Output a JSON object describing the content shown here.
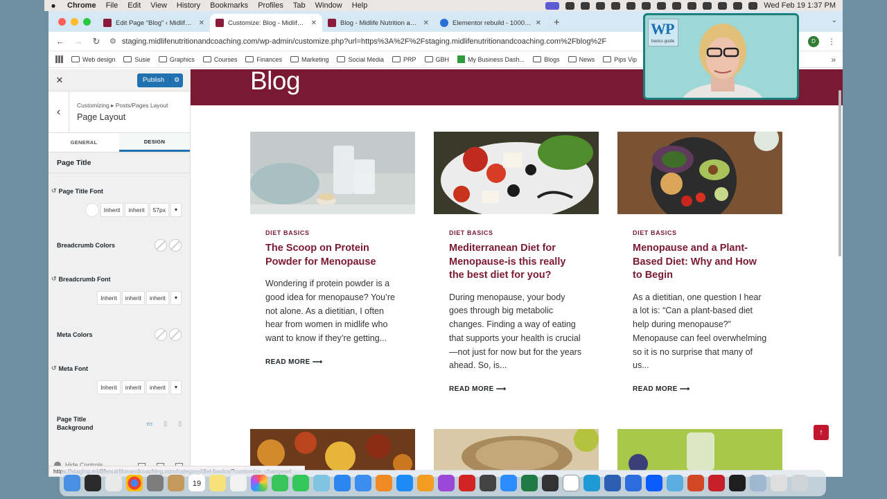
{
  "menubar": {
    "apple": "",
    "app": "Chrome",
    "items": [
      "File",
      "Edit",
      "View",
      "History",
      "Bookmarks",
      "Profiles",
      "Tab",
      "Window",
      "Help"
    ],
    "clock": "Wed Feb 19  1:37 PM"
  },
  "tabs": [
    {
      "label": "Edit Page “Blog” ‹ Midlife Nu",
      "active": false
    },
    {
      "label": "Customize: Blog - Midlife Nut",
      "active": true
    },
    {
      "label": "Blog - Midlife Nutrition and C",
      "active": false
    },
    {
      "label": "Elementor rebuild - 1000 × 3",
      "active": false
    }
  ],
  "toolbar": {
    "url": "staging.midlifenutritionandcoaching.com/wp-admin/customize.php?url=https%3A%2F%2Fstaging.midlifenutritionandcoaching.com%2Fblog%2F",
    "profile_initial": "D"
  },
  "bookmarks": [
    {
      "label": "Web design",
      "icon": "folder"
    },
    {
      "label": "Susie",
      "icon": "folder"
    },
    {
      "label": "Graphics",
      "icon": "folder"
    },
    {
      "label": "Courses",
      "icon": "folder"
    },
    {
      "label": "Finances",
      "icon": "folder"
    },
    {
      "label": "Marketing",
      "icon": "folder"
    },
    {
      "label": "Social Media",
      "icon": "folder"
    },
    {
      "label": "PRP",
      "icon": "folder"
    },
    {
      "label": "GBH",
      "icon": "folder"
    },
    {
      "label": "My Business Dash...",
      "icon": "green"
    },
    {
      "label": "Blogs",
      "icon": "folder"
    },
    {
      "label": "News",
      "icon": "folder"
    },
    {
      "label": "Pips Vip",
      "icon": "folder"
    }
  ],
  "customizer": {
    "close": "✕",
    "publish_label": "Publish",
    "breadcrumb": "Customizing ▸ Posts/Pages Layout",
    "title": "Page Layout",
    "tab_general": "GENERAL",
    "tab_design": "DESIGN",
    "section_title": "Page Title",
    "page_title_font": {
      "label": "Page Title Font",
      "family": "Inherit",
      "weight": "inherit",
      "size": "57px"
    },
    "breadcrumb_colors": {
      "label": "Breadcrumb Colors"
    },
    "breadcrumb_font": {
      "label": "Breadcrumb Font",
      "family": "Inherit",
      "weight": "inherit",
      "size": "inherit"
    },
    "meta_colors": {
      "label": "Meta Colors"
    },
    "meta_font": {
      "label": "Meta Font",
      "family": "Inherit",
      "weight": "inherit",
      "size": "inherit"
    },
    "page_title_background": {
      "label": "Page Title Background"
    },
    "hide_controls": "Hide Controls"
  },
  "preview": {
    "hero_title": "Blog",
    "posts": [
      {
        "category": "DIET BASICS",
        "title": "The Scoop on Protein Powder for Menopause",
        "excerpt": "Wondering if protein powder is a good idea for menopause? You’re not alone. As a dietitian, I often hear from women in midlife who want to know if they’re getting...",
        "read_more": "READ MORE ⟶"
      },
      {
        "category": "DIET BASICS",
        "title": "Mediterranean Diet for Menopause-is this really the best diet for you?",
        "excerpt": "During menopause, your body goes through big metabolic changes. Finding a way of eating that supports your health is crucial—not just for now but for the years ahead. So, is...",
        "read_more": "READ MORE ⟶"
      },
      {
        "category": "DIET BASICS",
        "title": "Menopause and a Plant-Based Diet: Why and How to Begin",
        "excerpt": "As a dietitian, one question I hear a lot is: “Can a plant-based diet help during menopause?” Menopause can feel overwhelming so it is no surprise that many of us...",
        "read_more": "READ MORE ⟶"
      }
    ],
    "back_to_top": "↑"
  },
  "status_url": "https://staging.midlifenutritionandcoaching.com/category/diet-basics/?customize_changeset_...",
  "webcam": {
    "logo_text": "WP",
    "logo_subtext": "basics guide"
  },
  "colors": {
    "brand": "#7a1a32",
    "accent": "#2271b1",
    "webcam_border": "#1d7f7c"
  },
  "dock": {
    "icons": [
      "finder-icon",
      "launchpad-icon",
      "apps-icon",
      "chrome-icon",
      "settings-icon",
      "finder-folder-icon",
      "calendar-icon",
      "notes-icon",
      "textedit-icon",
      "photos-icon",
      "facetime-icon",
      "messages-icon",
      "maps-icon",
      "files-icon",
      "mail-icon",
      "books-icon",
      "appstore-icon",
      "pages-icon",
      "podcasts-icon",
      "acrobat-icon",
      "sublime-icon",
      "safari-icon",
      "excel-icon",
      "quicktime-icon",
      "notion-icon",
      "edge-icon",
      "word-icon",
      "zoom-icon",
      "zoom-app-icon",
      "klack-icon",
      "powerpoint-icon",
      "screenflow-icon",
      "terminal-icon",
      "preview-icon",
      "finder-window-icon",
      "trash-icon"
    ],
    "calendar_day": "19",
    "calendar_month": "FEB"
  }
}
